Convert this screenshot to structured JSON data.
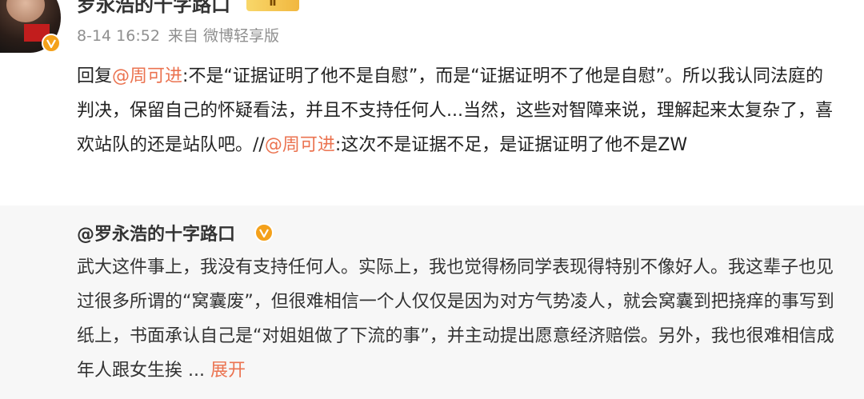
{
  "post": {
    "author_name": "罗永浩的十字路口",
    "level_badge": "Ⅱ",
    "timestamp": "8-14 16:52",
    "source": "来自 微博轻享版",
    "body": {
      "prefix": "回复",
      "mention1": "@周可进",
      "text1": ":不是“证据证明了他不是自慰”，而是“证据证明不了他是自慰”。所以我认同法庭的判决，保留自己的怀疑看法，并且不支持任何人...当然，这些对智障来说，理解起来太复杂了，喜欢站队的还是站队吧。//",
      "mention2": "@周可进",
      "text2": ":这次不是证据不足，是证据证明了他不是ZW"
    }
  },
  "quote": {
    "author": "@罗永浩的十字路口",
    "body": "武大这件事上，我没有支持任何人。实际上，我也觉得杨同学表现得特别不像好人。我这辈子也见过很多所谓的“窝囊废”，但很难相信一个人仅仅是因为对方气势凌人，就会窝囊到把挠痒的事写到纸上，书面承认自己是“对姐姐做了下流的事”，并主动提出愿意经济赔偿。另外，我也很难相信成年人跟女生挨",
    "ellipsis": " ... ",
    "expand_label": "展开"
  },
  "colors": {
    "mention": "#eb7350",
    "verify": "#f4a11b",
    "quote_bg": "#f7f7f7"
  },
  "icons": {
    "avatar": "avatar-image",
    "verified": "verified-v-icon",
    "level": "level-badge-icon"
  }
}
